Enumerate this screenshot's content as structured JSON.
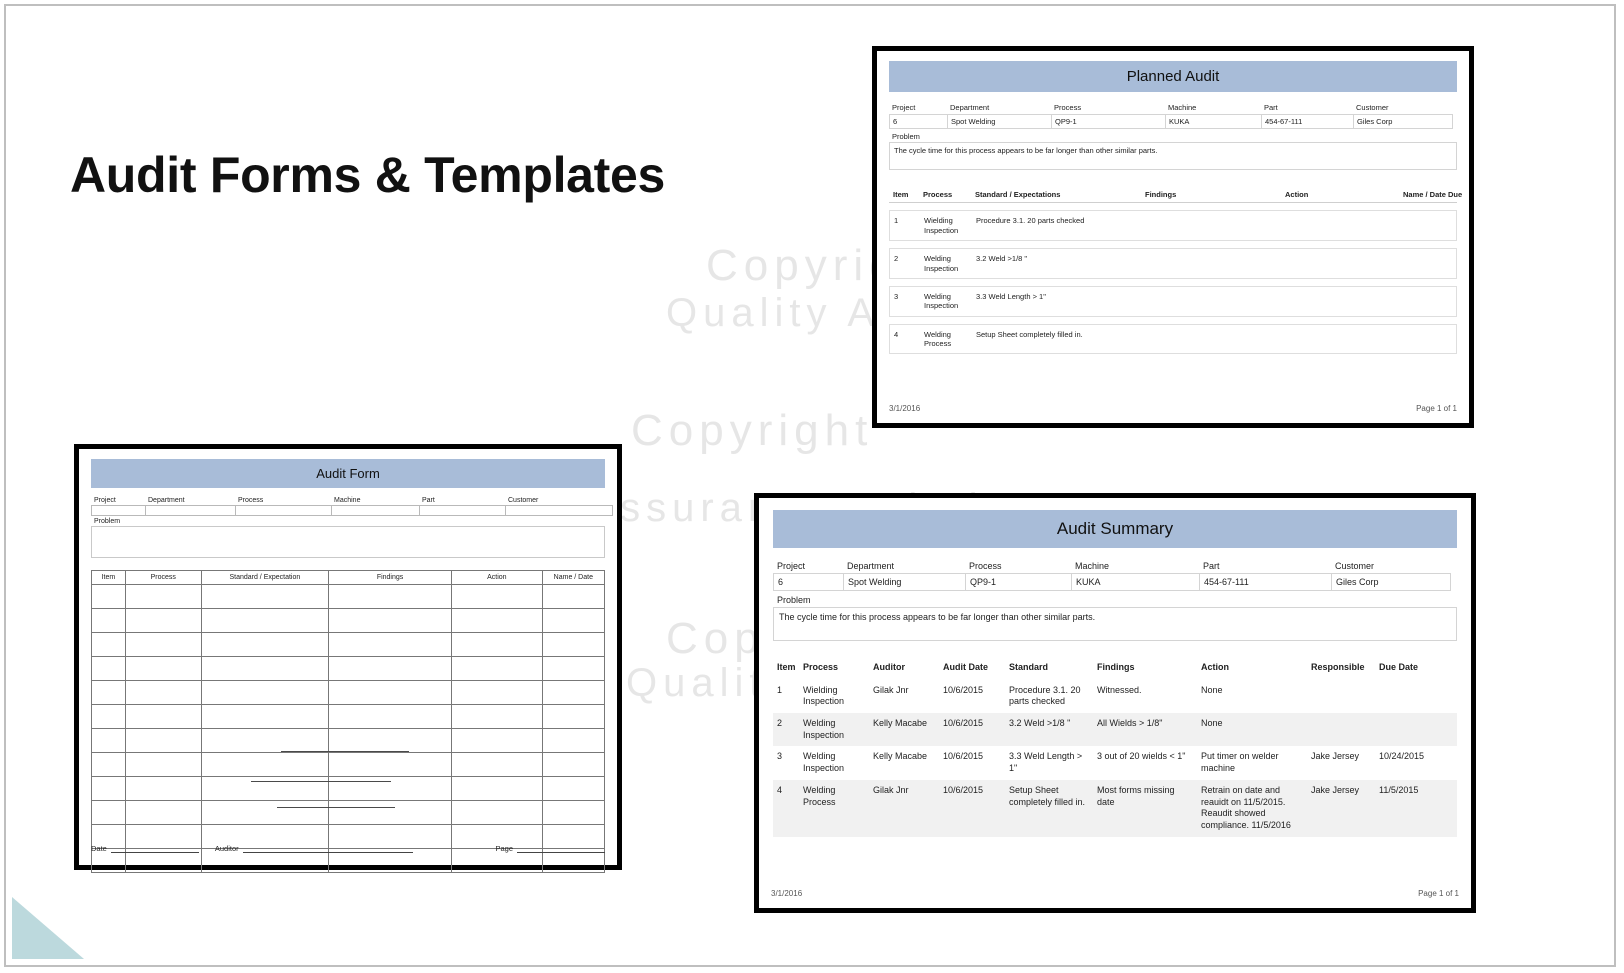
{
  "slide": {
    "title": "Audit Forms & Templates",
    "watermark_line_1": "Copyright",
    "watermark_line_2": "Quality Assurance Solutions"
  },
  "planned_audit": {
    "title": "Planned Audit",
    "meta_headers": [
      "Project",
      "Department",
      "Process",
      "Machine",
      "Part",
      "Customer"
    ],
    "meta_values": [
      "6",
      "Spot Welding",
      "QP9-1",
      "KUKA",
      "454-67-111",
      "Giles Corp"
    ],
    "problem_label": "Problem",
    "problem_text": "The cycle time for this process appears to be far longer than other similar parts.",
    "columns": [
      "Item",
      "Process",
      "Standard / Expectations",
      "Findings",
      "Action",
      "Name / Date Due"
    ],
    "rows": [
      {
        "item": "1",
        "process": "Wielding Inspection",
        "standard": "Procedure 3.1. 20 parts checked",
        "findings": "",
        "action": "",
        "name_date": ""
      },
      {
        "item": "2",
        "process": "Welding Inspection",
        "standard": "3.2  Weld >1/8 \"",
        "findings": "",
        "action": "",
        "name_date": ""
      },
      {
        "item": "3",
        "process": "Welding Inspection",
        "standard": "3.3  Weld  Length > 1\"",
        "findings": "",
        "action": "",
        "name_date": ""
      },
      {
        "item": "4",
        "process": "Welding Process",
        "standard": "Setup Sheet completely filled in.",
        "findings": "",
        "action": "",
        "name_date": ""
      }
    ],
    "footer_date": "3/1/2016",
    "footer_page": "Page 1 of 1"
  },
  "audit_summary": {
    "title": "Audit Summary",
    "meta_headers": [
      "Project",
      "Department",
      "Process",
      "Machine",
      "Part",
      "Customer"
    ],
    "meta_values": [
      "6",
      "Spot Welding",
      "QP9-1",
      "KUKA",
      "454-67-111",
      "Giles Corp"
    ],
    "problem_label": "Problem",
    "problem_text": "The cycle time for this process appears to be far longer than other similar parts.",
    "columns": [
      "Item",
      "Process",
      "Auditor",
      "Audit Date",
      "Standard",
      "Findings",
      "Action",
      "Responsible",
      "Due Date"
    ],
    "rows": [
      {
        "item": "1",
        "process": "Wielding Inspection",
        "auditor": "Gilak Jnr",
        "audit_date": "10/6/2015",
        "standard": "Procedure 3.1. 20 parts checked",
        "findings": "Witnessed.",
        "action": "None",
        "responsible": "",
        "due_date": ""
      },
      {
        "item": "2",
        "process": "Welding Inspection",
        "auditor": "Kelly Macabe",
        "audit_date": "10/6/2015",
        "standard": "3.2  Weld >1/8 \"",
        "findings": "All Wields > 1/8\"",
        "action": "None",
        "responsible": "",
        "due_date": ""
      },
      {
        "item": "3",
        "process": "Welding Inspection",
        "auditor": "Kelly Macabe",
        "audit_date": "10/6/2015",
        "standard": "3.3  Weld  Length > 1\"",
        "findings": "3 out of 20 wields < 1\"",
        "action": "Put timer on welder machine",
        "responsible": "Jake Jersey",
        "due_date": "10/24/2015"
      },
      {
        "item": "4",
        "process": "Welding Process",
        "auditor": "Gilak Jnr",
        "audit_date": "10/6/2015",
        "standard": "Setup Sheet completely filled in.",
        "findings": "Most forms missing date",
        "action": "Retrain on date and reauidt on 11/5/2015. Reaudit showed compliance. 11/5/2016",
        "responsible": "Jake Jersey",
        "due_date": "11/5/2015"
      }
    ],
    "footer_date": "3/1/2016",
    "footer_page": "Page 1 of 1"
  },
  "audit_form": {
    "title": "Audit Form",
    "meta_headers": [
      "Project",
      "Department",
      "Process",
      "Machine",
      "Part",
      "Customer"
    ],
    "problem_label": "Problem",
    "columns": [
      "Item",
      "Process",
      "Standard / Expectation",
      "Findings",
      "Action",
      "Name / Date"
    ],
    "blank_row_count": 12,
    "footer_date_label": "Date",
    "footer_auditor_label": "Auditor",
    "footer_page_label": "Page"
  },
  "colors": {
    "header_band": "#a8bcd8",
    "frame": "#000000",
    "accent_corner": "#bcd9dd",
    "alt_row": "#f1f1f1"
  }
}
